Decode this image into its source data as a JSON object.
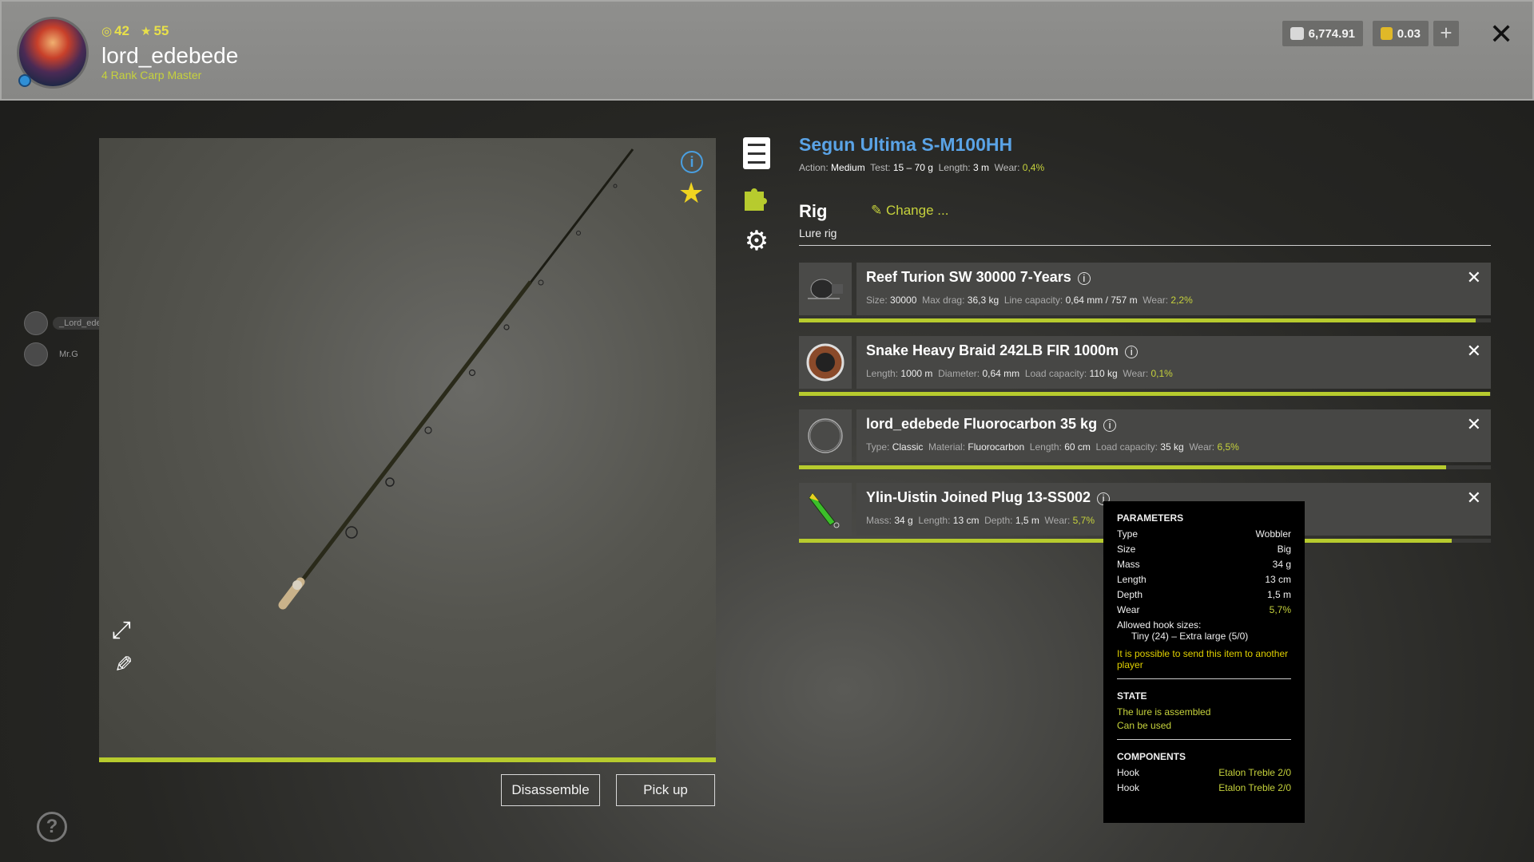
{
  "header": {
    "level": "42",
    "rank_stars": "55",
    "username": "lord_edebede",
    "rank_title": "4 Rank Carp Master",
    "silver": "6,774.91",
    "gold": "0.03",
    "plus_label": "+",
    "close_label": "✕"
  },
  "friends": [
    {
      "name": "_Lord_edebede_"
    },
    {
      "name": "Mr.G"
    }
  ],
  "viewer": {
    "info_label": "i",
    "disassemble_label": "Disassemble",
    "pickup_label": "Pick up",
    "help_label": "?"
  },
  "rod": {
    "title": "Segun Ultima S-M100HH",
    "action_label": "Action:",
    "action": "Medium",
    "test_label": "Test:",
    "test": "15 – 70 g",
    "length_label": "Length:",
    "length": "3 m",
    "wear_label": "Wear:",
    "wear": "0,4%"
  },
  "rig": {
    "label": "Rig",
    "type": "Lure rig",
    "change_label": "Change ..."
  },
  "items": [
    {
      "name": "Reef Turion SW 30000 7-Years",
      "specs": [
        {
          "k": "Size:",
          "v": "30000"
        },
        {
          "k": "Max drag:",
          "v": "36,3 kg"
        },
        {
          "k": "Line capacity:",
          "v": "0,64 mm / 757 m"
        }
      ],
      "wear": "2,2%",
      "condition": 0.978
    },
    {
      "name": "Snake Heavy Braid 242LB FIR 1000m",
      "specs": [
        {
          "k": "Length:",
          "v": "1000 m"
        },
        {
          "k": "Diameter:",
          "v": "0,64 mm"
        },
        {
          "k": "Load capacity:",
          "v": "110 kg"
        }
      ],
      "wear": "0,1%",
      "condition": 0.999
    },
    {
      "name": "lord_edebede Fluorocarbon 35 kg",
      "specs": [
        {
          "k": "Type:",
          "v": "Classic"
        },
        {
          "k": "Material:",
          "v": "Fluorocarbon"
        },
        {
          "k": "Length:",
          "v": "60 cm"
        },
        {
          "k": "Load capacity:",
          "v": "35 kg"
        }
      ],
      "wear": "6,5%",
      "condition": 0.935
    },
    {
      "name": "Ylin-Uistin Joined Plug 13-SS002",
      "specs": [
        {
          "k": "Mass:",
          "v": "34 g"
        },
        {
          "k": "Length:",
          "v": "13 cm"
        },
        {
          "k": "Depth:",
          "v": "1,5 m"
        }
      ],
      "wear": "5,7%",
      "condition": 0.943
    }
  ],
  "tooltip": {
    "params_header": "PARAMETERS",
    "params": [
      {
        "k": "Type",
        "v": "Wobbler"
      },
      {
        "k": "Size",
        "v": "Big"
      },
      {
        "k": "Mass",
        "v": "34 g"
      },
      {
        "k": "Length",
        "v": "13 cm"
      },
      {
        "k": "Depth",
        "v": "1,5 m"
      },
      {
        "k": "Wear",
        "v": "5,7%"
      }
    ],
    "hook_sizes_label": "Allowed hook sizes:",
    "hook_sizes": "Tiny (24) – Extra large (5/0)",
    "send_note": "It is possible to send this item to another player",
    "state_header": "STATE",
    "state_1": "The lure is assembled",
    "state_2": "Can be used",
    "components_header": "COMPONENTS",
    "components": [
      {
        "k": "Hook",
        "v": "Etalon Treble 2/0"
      },
      {
        "k": "Hook",
        "v": "Etalon Treble 2/0"
      }
    ]
  },
  "colors": {
    "accent_green": "#b7cb2e",
    "title_blue": "#5aa3e6",
    "wear_green": "#c6d23c"
  }
}
